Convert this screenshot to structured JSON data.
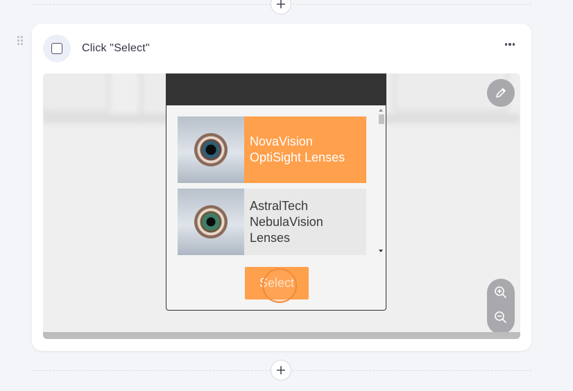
{
  "step": {
    "title": "Click \"Select\""
  },
  "screenshot": {
    "list_items": [
      {
        "label": "NovaVision OptiSight Lenses",
        "selected": true,
        "image": "eye-blue-icon"
      },
      {
        "label": "AstralTech NebulaVision Lenses",
        "selected": false,
        "image": "eye-green-icon"
      }
    ],
    "select_button": "Select"
  },
  "icons": {
    "add": "plus-icon",
    "more": "more-horizontal-icon",
    "edit": "pencil-icon",
    "zoom_in": "zoom-in-icon",
    "zoom_out": "zoom-out-icon",
    "drag": "drag-handle-icon"
  },
  "colors": {
    "accent": "#ffa04c",
    "header_dark": "#333333",
    "page_bg": "#f4f5f8",
    "control_gray": "#a8a8ad"
  }
}
